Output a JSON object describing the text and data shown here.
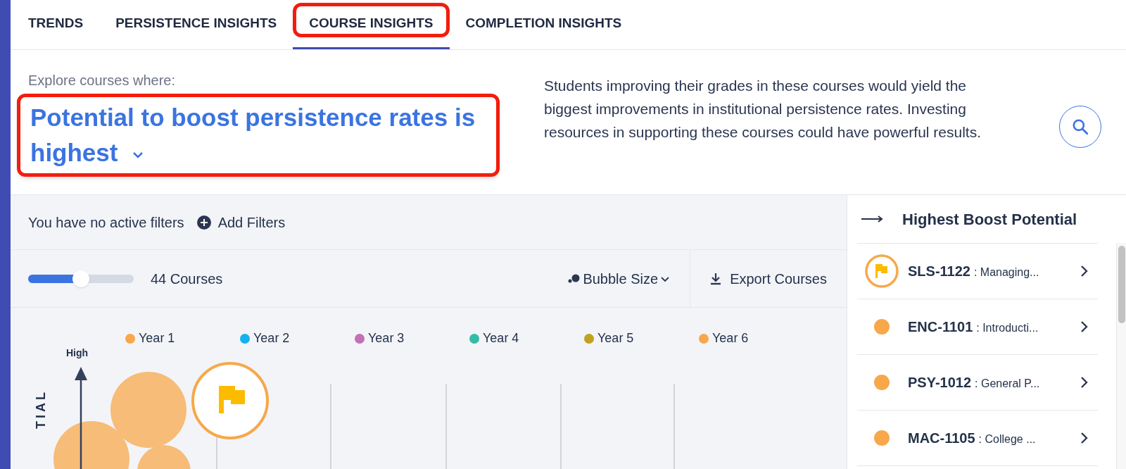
{
  "tabs": [
    {
      "label": "TRENDS",
      "selected": false,
      "highlighted": false
    },
    {
      "label": "PERSISTENCE INSIGHTS",
      "selected": false,
      "highlighted": false
    },
    {
      "label": "COURSE INSIGHTS",
      "selected": true,
      "highlighted": true
    },
    {
      "label": "COMPLETION INSIGHTS",
      "selected": false,
      "highlighted": false
    }
  ],
  "explore": {
    "label": "Explore courses where:",
    "selection": "Potential to boost persistence rates is highest",
    "highlighted": true
  },
  "description": "Students improving their grades in these courses would yield the biggest improvements in institutional persistence rates. Investing resources in supporting these courses could have powerful results.",
  "filters": {
    "status": "You have no active filters",
    "add_button": "Add Filters"
  },
  "toolbar": {
    "slider": {
      "level": 0.5
    },
    "count": "44 Courses",
    "bubble_size": "Bubble Size",
    "export": "Export Courses"
  },
  "chart": {
    "legend": [
      {
        "label": "Year 1",
        "color": "#f8a84a"
      },
      {
        "label": "Year 2",
        "color": "#16b0ef"
      },
      {
        "label": "Year 3",
        "color": "#c470b4"
      },
      {
        "label": "Year 4",
        "color": "#36bba6"
      },
      {
        "label": "Year 5",
        "color": "#c0a21f"
      },
      {
        "label": "Year 6",
        "color": "#f8a84a"
      }
    ],
    "y_top_label": "High",
    "y_axis_label": "TIAL"
  },
  "side_panel": {
    "title": "Highest Boost Potential",
    "courses": [
      {
        "kind": "flag",
        "code": "SLS-1122",
        "name": ": Managing...",
        "color": "#f8a84a"
      },
      {
        "kind": "dot",
        "code": "ENC-1101",
        "name": ": Introducti...",
        "color": "#f8a84a"
      },
      {
        "kind": "dot",
        "code": "PSY-1012",
        "name": ": General P...",
        "color": "#f8a84a"
      },
      {
        "kind": "dot",
        "code": "MAC-1105",
        "name": ": College ...",
        "color": "#f8a84a"
      }
    ]
  }
}
